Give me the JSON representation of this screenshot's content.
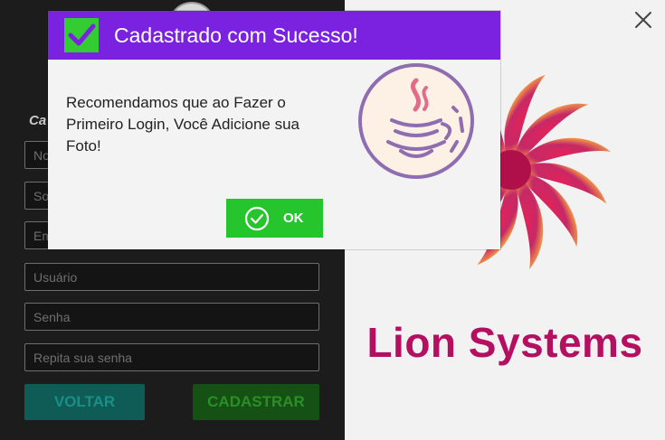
{
  "form": {
    "title": "Ca",
    "fields": [
      {
        "placeholder": "No"
      },
      {
        "placeholder": "So"
      },
      {
        "placeholder": "Em"
      },
      {
        "placeholder": "Usuário"
      },
      {
        "placeholder": "Senha"
      },
      {
        "placeholder": "Repita sua senha"
      }
    ],
    "back_label": "VOLTAR",
    "register_label": "CADASTRAR"
  },
  "brand": {
    "name": "Lion Systems",
    "color": "#b50f62"
  },
  "dialog": {
    "title": "Cadastrado com Sucesso!",
    "message": "Recomendamos que ao Fazer o Primeiro Login, Você Adicione sua Foto!",
    "ok_label": "OK",
    "header_color": "#7b22e0",
    "ok_color": "#27c52d",
    "icons": [
      "check-icon",
      "java-logo-icon",
      "check-circle-icon"
    ]
  },
  "window": {
    "close_icon": "close-icon"
  }
}
